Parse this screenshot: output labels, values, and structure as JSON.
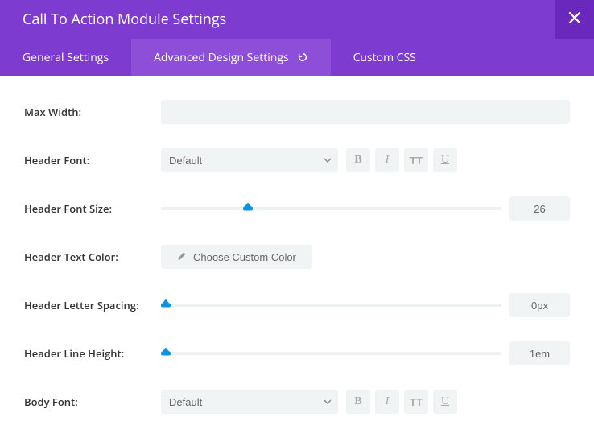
{
  "title": "Call To Action Module Settings",
  "tabs": {
    "general": "General Settings",
    "advanced": "Advanced Design Settings",
    "css": "Custom CSS"
  },
  "labels": {
    "max_width": "Max Width:",
    "header_font": "Header Font:",
    "header_font_size": "Header Font Size:",
    "header_text_color": "Header Text Color:",
    "header_letter_spacing": "Header Letter Spacing:",
    "header_line_height": "Header Line Height:",
    "body_font": "Body Font:"
  },
  "values": {
    "max_width": "",
    "header_font": "Default",
    "header_font_size": "26",
    "header_letter_spacing": "0px",
    "header_line_height": "1em",
    "body_font": "Default"
  },
  "buttons": {
    "choose_color": "Choose Custom Color"
  },
  "sliders": {
    "header_font_size_pct": 25.5,
    "header_letter_spacing_pct": 1.5,
    "header_line_height_pct": 1.5
  },
  "style_glyphs": {
    "bold": "B",
    "italic": "I",
    "tt": "TT",
    "underline": "U"
  }
}
